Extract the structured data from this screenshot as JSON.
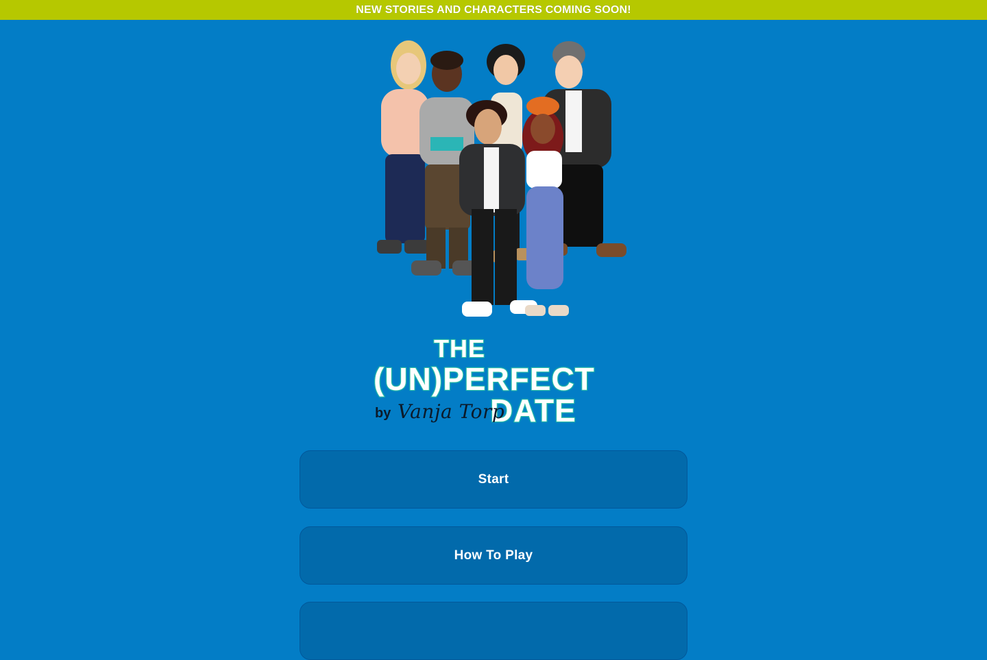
{
  "banner": {
    "text": "NEW STORIES AND CHARACTERS COMING SOON!"
  },
  "logo": {
    "line1": "THE",
    "line2": "(UN)PERFECT",
    "line3": "DATE",
    "by": "by",
    "author": "Vanja Torp"
  },
  "menu": {
    "start_label": "Start",
    "how_to_play_label": "How To Play",
    "third_label": ""
  },
  "colors": {
    "background": "#037dc6",
    "banner": "#b6c800",
    "button": "#026aab",
    "logo_outline": "#2ec0a6"
  }
}
